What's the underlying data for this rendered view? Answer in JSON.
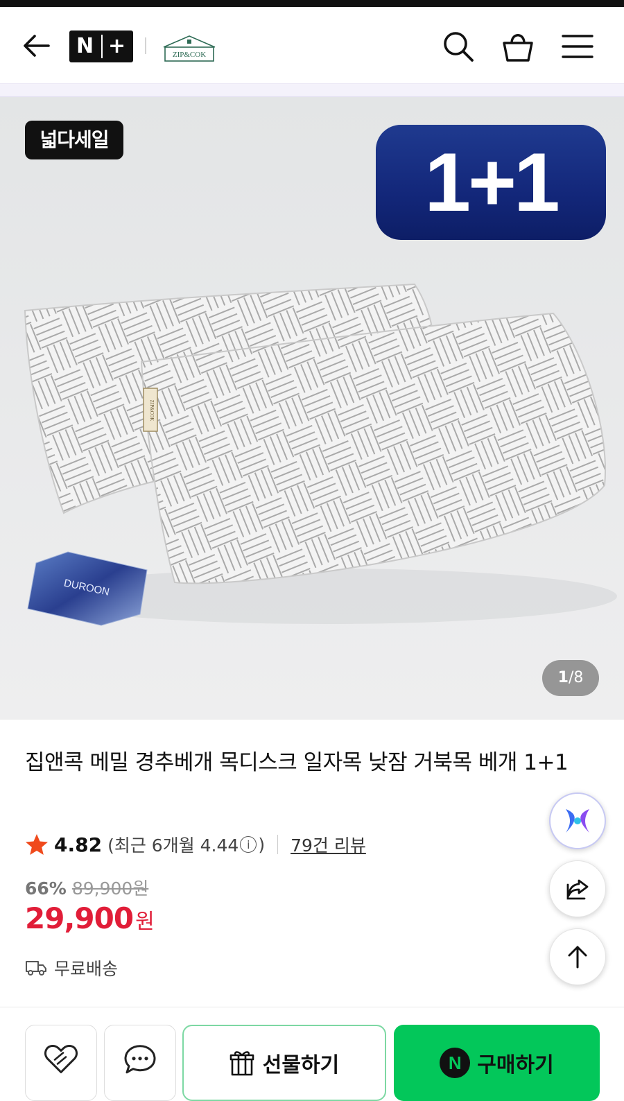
{
  "header": {
    "naver_plus": {
      "n": "N",
      "plus": "+"
    },
    "store_logo_text": "ZIP&COK",
    "icons": [
      "back-arrow-icon",
      "search-icon",
      "shopping-bag-icon",
      "menu-icon"
    ]
  },
  "gallery": {
    "sale_badge": "넓다세일",
    "promo": "1+1",
    "counter_current": "1",
    "counter_total": "/8",
    "product_tag": "ZIP&COK",
    "card_text": "DUROON"
  },
  "product": {
    "title": "집앤콕 메밀 경추베개 목디스크 일자목 낮잠 거북목 베개 1+1",
    "rating": "4.82",
    "recent_prefix": "(최근 6개월 4.44",
    "recent_suffix": ")",
    "reviews": "79건 리뷰",
    "discount": "66%",
    "original_price": "89,900원",
    "price": "29,900",
    "currency": "원",
    "shipping": "무료배송"
  },
  "actions": {
    "gift": "선물하기",
    "buy": "구매하기",
    "buy_badge": "N"
  },
  "colors": {
    "price_red": "#e11d38",
    "buy_green": "#03c75a",
    "promo_blue": "#13277a"
  }
}
